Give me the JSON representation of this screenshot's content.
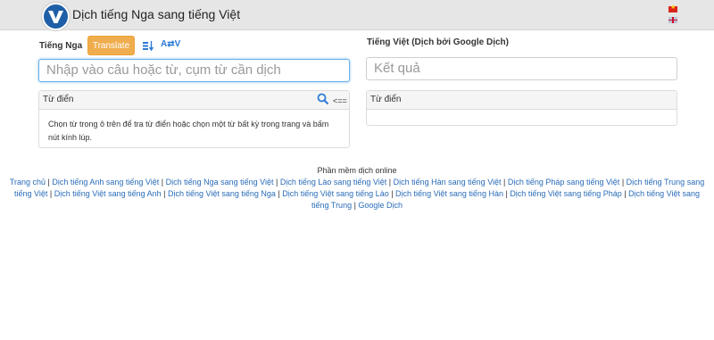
{
  "header": {
    "title": "Dịch tiếng Nga sang tiếng Việt"
  },
  "source": {
    "language_label": "Tiếng Nga",
    "translate_label": "Translate",
    "swap_label": "A⇄V",
    "input_placeholder": "Nhập vào câu hoặc từ, cụm từ cần dịch",
    "dictionary_label": "Từ điển",
    "back_label": "<==",
    "dictionary_help": "Chọn từ trong ô trên để tra từ điển hoặc chọn một từ bất kỳ trong trang và bấm nút kính lúp."
  },
  "target": {
    "language_label": "Tiếng Việt (Dịch bởi Google Dịch)",
    "result_placeholder": "Kết quả",
    "dictionary_label": "Từ điển"
  },
  "footer": {
    "title": "Phần mềm dịch online",
    "links": [
      "Trang chủ",
      "Dịch tiếng Anh sang tiếng Việt",
      "Dịch tiếng Nga sang tiếng Việt",
      "Dịch tiếng Lào sang tiếng Việt",
      "Dịch tiếng Hàn sang tiếng Việt",
      "Dịch tiếng Pháp sang tiếng Việt",
      "Dịch tiếng Trung sang tiếng Việt",
      "Dịch tiếng Việt sang tiếng Anh",
      "Dịch tiếng Việt sang tiếng Nga",
      "Dịch tiếng Việt sang tiếng Lào",
      "Dịch tiếng Việt sang tiếng Hàn",
      "Dịch tiếng Việt sang tiếng Pháp",
      "Dịch tiếng Việt sang tiếng Trung",
      "Google Dịch"
    ]
  },
  "icons": {
    "logo": "logo-v-icon",
    "sort": "sort-icon",
    "search": "search-icon",
    "flag_vi": "flag-vietnam-icon",
    "flag_en": "flag-uk-icon"
  },
  "colors": {
    "translate_button": "#f0ad4e",
    "link": "#2a6cb8",
    "focus_border": "#66afe9"
  }
}
